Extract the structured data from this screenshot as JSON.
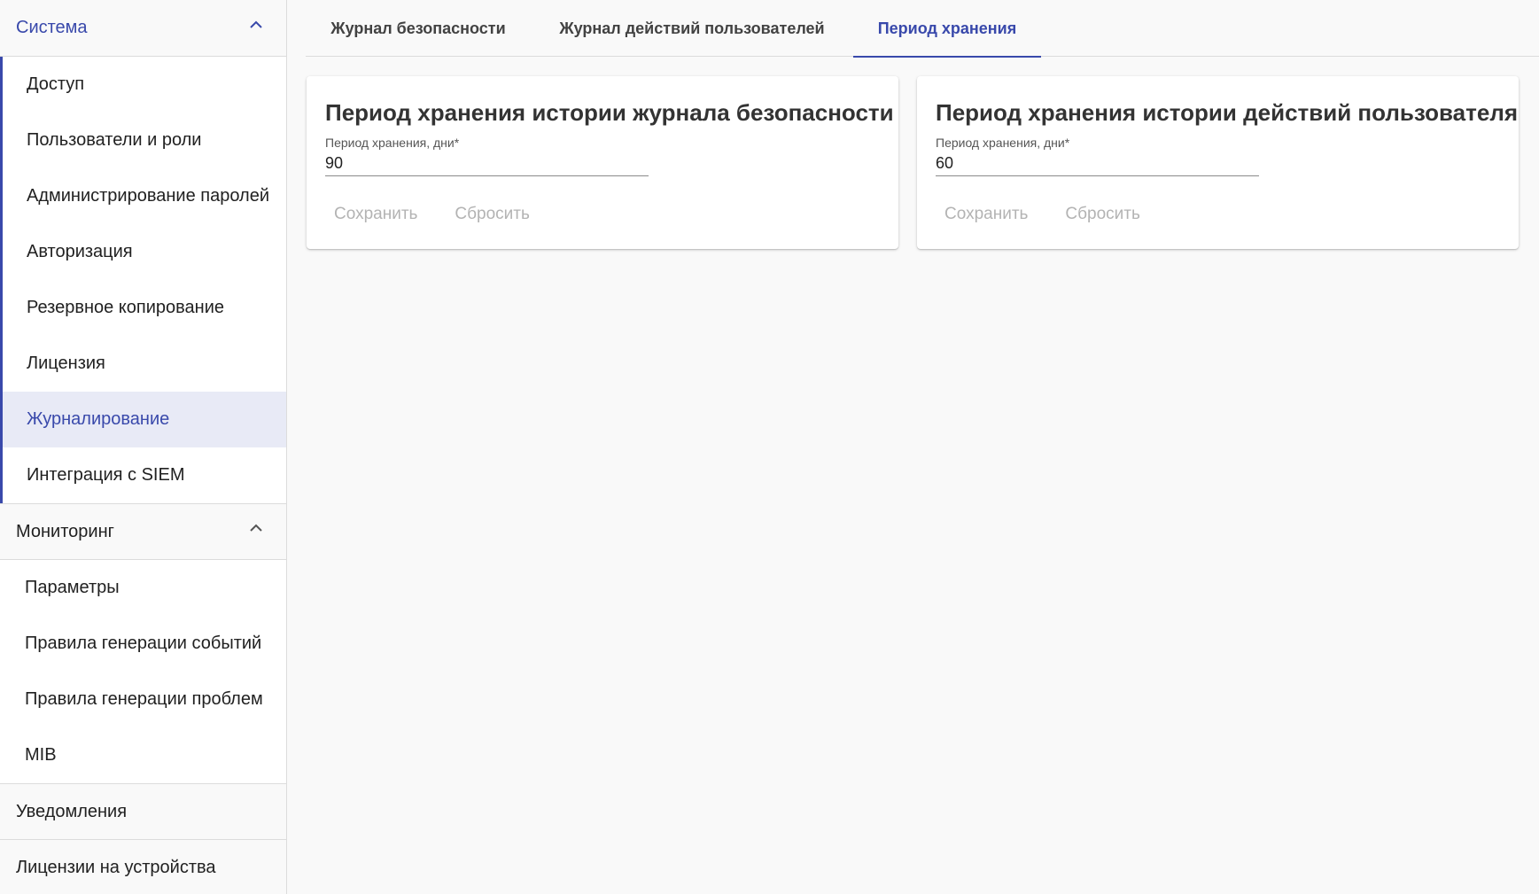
{
  "sidebar": {
    "groups": [
      {
        "label": "Система",
        "expanded": true,
        "items": [
          {
            "label": "Доступ"
          },
          {
            "label": "Пользователи и роли"
          },
          {
            "label": "Администрирование паролей"
          },
          {
            "label": "Авторизация"
          },
          {
            "label": "Резервное копирование"
          },
          {
            "label": "Лицензия"
          },
          {
            "label": "Журналирование",
            "selected": true
          },
          {
            "label": "Интеграция с SIEM"
          }
        ]
      },
      {
        "label": "Мониторинг",
        "expanded": true,
        "items": [
          {
            "label": "Параметры"
          },
          {
            "label": "Правила генерации событий"
          },
          {
            "label": "Правила генерации проблем"
          },
          {
            "label": "MIB"
          }
        ]
      },
      {
        "label": "Уведомления",
        "expanded": false
      },
      {
        "label": "Лицензии на устройства",
        "expanded": false
      }
    ]
  },
  "tabs": [
    {
      "label": "Журнал безопасности"
    },
    {
      "label": "Журнал действий пользователей"
    },
    {
      "label": "Период хранения",
      "active": true
    }
  ],
  "cards": [
    {
      "title": "Период хранения истории журнала безопасности",
      "field_label": "Период хранения, дни*",
      "field_value": "90",
      "save_label": "Сохранить",
      "reset_label": "Сбросить"
    },
    {
      "title": "Период хранения истории действий пользователя",
      "field_label": "Период хранения, дни*",
      "field_value": "60",
      "save_label": "Сохранить",
      "reset_label": "Сбросить"
    }
  ],
  "colors": {
    "accent": "#3949ab",
    "selected_bg": "#e8eaf6",
    "disabled_text": "#b3b3b3"
  },
  "icons": {
    "collapse": "chevron-up-icon"
  }
}
